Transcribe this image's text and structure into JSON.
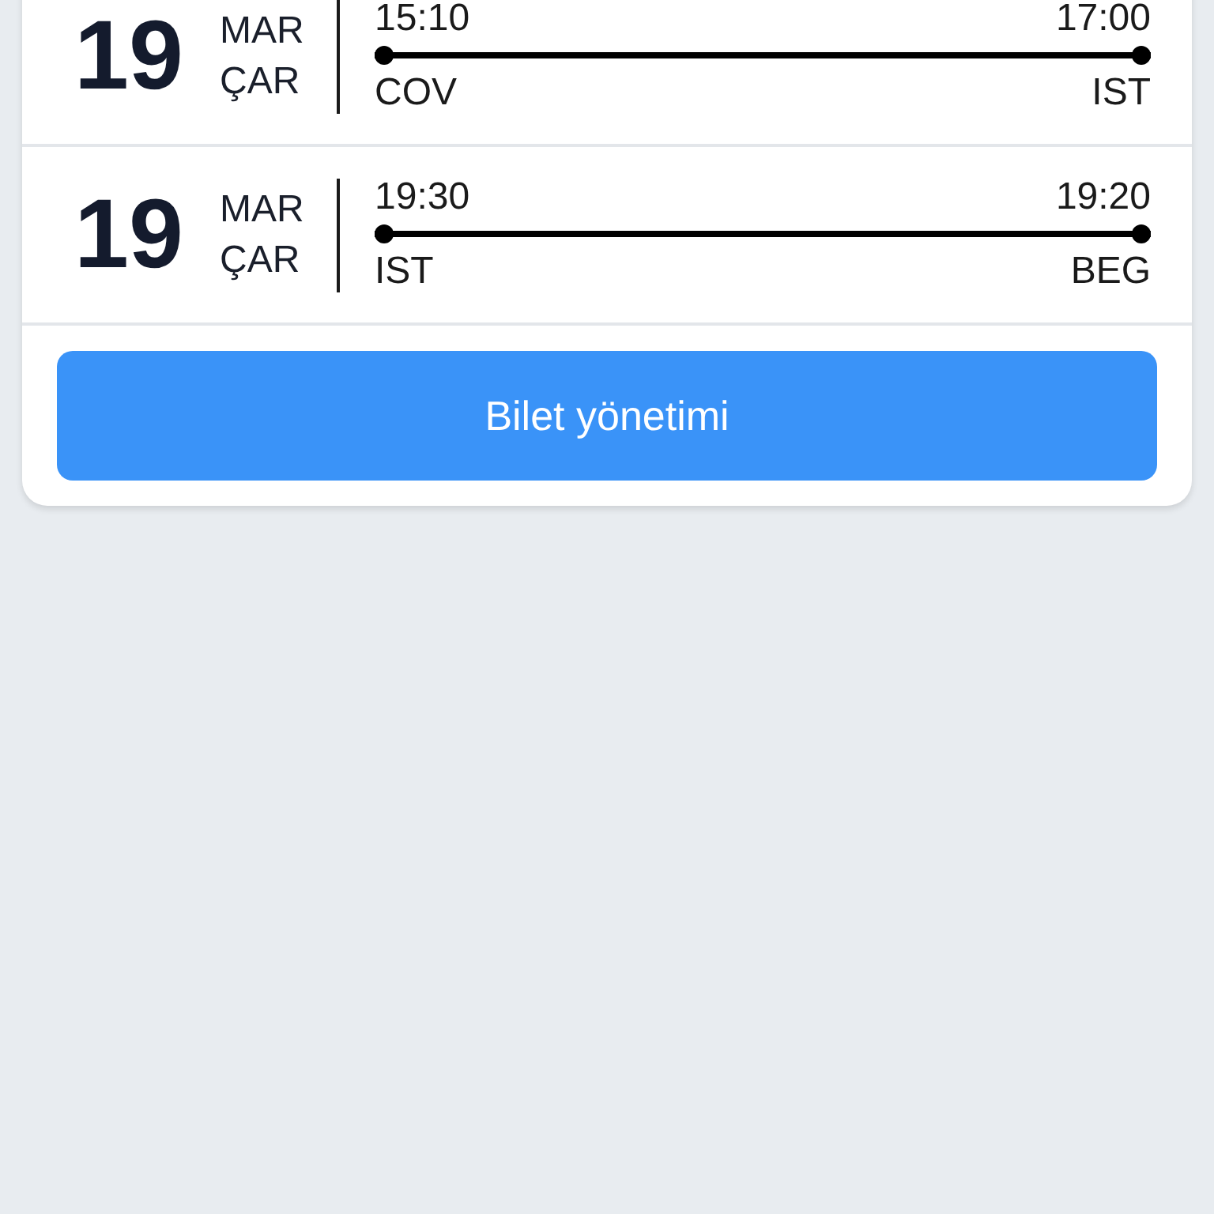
{
  "flights": [
    {
      "day": "19",
      "month": "MAR",
      "weekday": "ÇAR",
      "departure_time": "15:10",
      "arrival_time": "17:00",
      "origin": "COV",
      "destination": "IST"
    },
    {
      "day": "19",
      "month": "MAR",
      "weekday": "ÇAR",
      "departure_time": "19:30",
      "arrival_time": "19:20",
      "origin": "IST",
      "destination": "BEG"
    }
  ],
  "button": "Bilet yönetimi"
}
